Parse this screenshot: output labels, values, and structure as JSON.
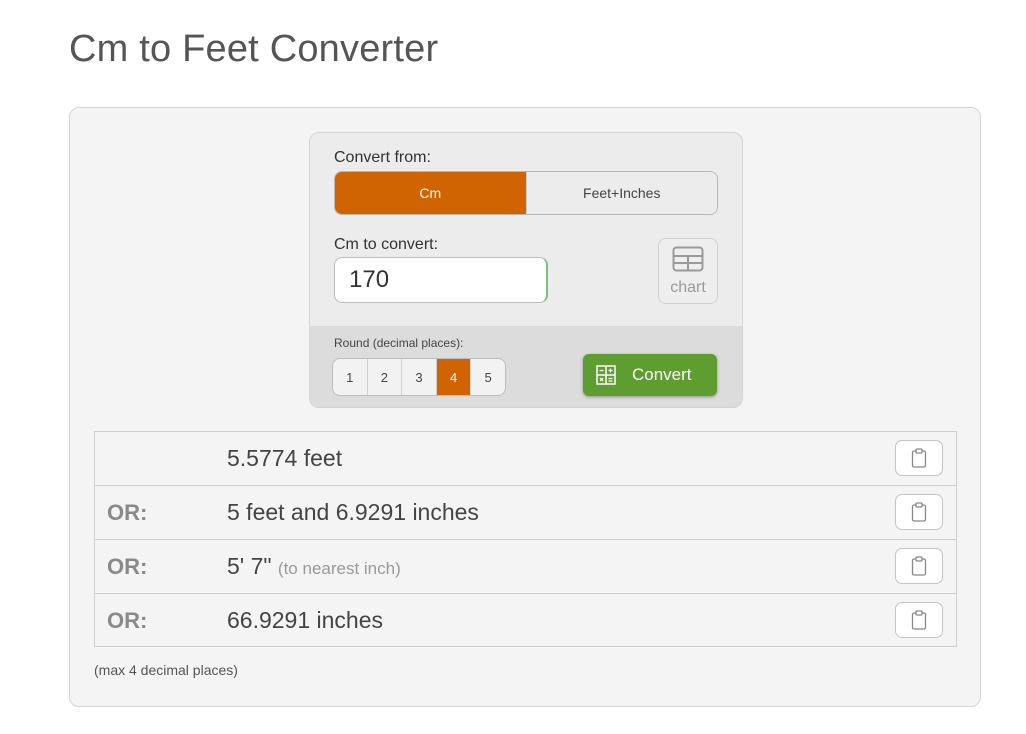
{
  "page": {
    "title": "Cm to Feet Converter"
  },
  "converter": {
    "convert_from_label": "Convert from:",
    "from_options": [
      "Cm",
      "Feet+Inches"
    ],
    "selected_from": "Cm",
    "input_label": "Cm to convert:",
    "input_value": "170",
    "chart_button": {
      "label": "chart",
      "icon": "table-icon"
    },
    "round_label": "Round (decimal places):",
    "round_options": [
      "1",
      "2",
      "3",
      "4",
      "5"
    ],
    "selected_round": "4",
    "convert_button": {
      "label": "Convert",
      "icon": "calculator-icon"
    }
  },
  "results": [
    {
      "prefix": "",
      "value": "5.5774 feet",
      "note": ""
    },
    {
      "prefix": "OR:",
      "value": "5 feet and 6.9291 inches",
      "note": ""
    },
    {
      "prefix": "OR:",
      "value": "5' 7\"",
      "note": "(to nearest inch)"
    },
    {
      "prefix": "OR:",
      "value": "66.9291 inches",
      "note": ""
    }
  ],
  "copy_icon": "clipboard-icon",
  "footnote": "(max 4 decimal places)",
  "colors": {
    "accent_orange": "#d06400",
    "convert_green": "#5e9d2f"
  }
}
